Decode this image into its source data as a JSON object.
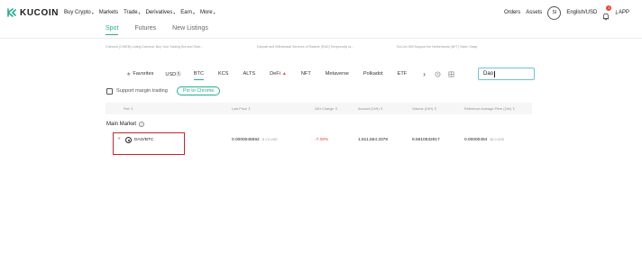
{
  "brand": {
    "name": "KUCOIN",
    "accent": "#24ae8f",
    "negative": "#e8453c"
  },
  "nav": {
    "items": [
      {
        "label": "Buy Crypto",
        "dropdown": true
      },
      {
        "label": "Markets",
        "dropdown": false
      },
      {
        "label": "Trade",
        "dropdown": true
      },
      {
        "label": "Derivatives",
        "dropdown": true
      },
      {
        "label": "Earn",
        "dropdown": true
      },
      {
        "label": "More",
        "dropdown": true
      }
    ],
    "orders": "Orders",
    "assets": "Assets",
    "avatar": "SI",
    "language": "English/USD",
    "notification_count": "1",
    "app": "APP"
  },
  "market_tabs": {
    "items": [
      "Spot",
      "Futures",
      "New Listings"
    ],
    "active": "Spot"
  },
  "announcements": [
    "Coinweb (CWEB) Listing Carnival: Buy Your Trading Bot and Shar...",
    "Deposit and Withdrawal Services of Radicle (RAD) Temporarily Ia...",
    "KuCoin Will Support the Netherlands (NFT) Token Swap"
  ],
  "categories": {
    "favorites": "Favorites",
    "items": [
      "USDⓈ",
      "BTC",
      "KCS",
      "ALTS",
      "DeFi",
      "NFT",
      "Metaverse",
      "Polkadot",
      "ETF"
    ],
    "active": "BTC",
    "more": "›"
  },
  "search": {
    "value": "Dao"
  },
  "margin": {
    "label": "Support margin trading",
    "pin_button": "Pin to Chrome"
  },
  "table": {
    "headers": [
      "Pair ⇕",
      "Last Price ⇕",
      "24H Change ⇕",
      "Amount (24H) ⇕",
      "Volume (24H) ⇕",
      "Reference Average Price (24h) ⇕"
    ],
    "section_title": "Main Market",
    "rows": [
      {
        "pair": "DAO/BTC",
        "last_price": "0.0000046592",
        "last_price_usd": "$ 1.9 USD",
        "change": "-7.09%",
        "amount": "1,811,564.3378",
        "volume": "8.5610532817",
        "ref_price": "0.00000494",
        "ref_price_usd": "$2.0 USD"
      }
    ]
  }
}
